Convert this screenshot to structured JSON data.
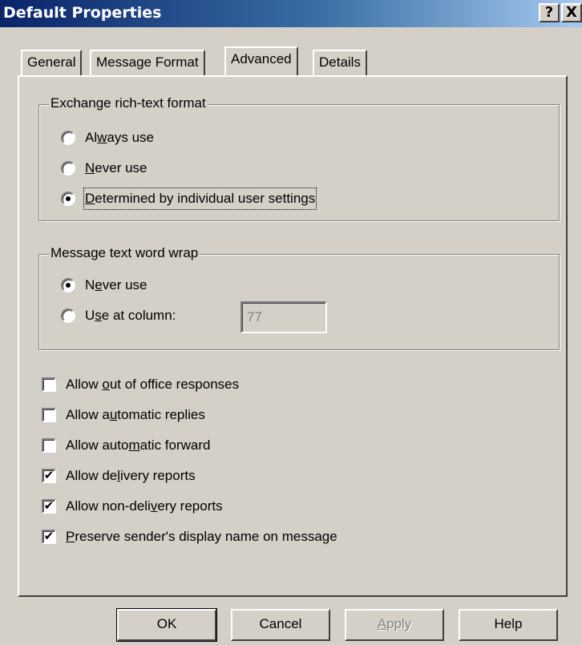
{
  "window": {
    "title": "Default Properties",
    "help_button": "?",
    "close_button": "X"
  },
  "tabs": [
    {
      "label": "General",
      "active": false
    },
    {
      "label": "Message Format",
      "active": false
    },
    {
      "label": "Advanced",
      "active": true
    },
    {
      "label": "Details",
      "active": false
    }
  ],
  "rich_text_group": {
    "legend": "Exchange rich-text format",
    "options": [
      {
        "pre": "Al",
        "key": "w",
        "post": "ays use",
        "selected": false
      },
      {
        "pre": "",
        "key": "N",
        "post": "ever use",
        "selected": false
      },
      {
        "pre": "",
        "key": "D",
        "post": "etermined by individual user settings",
        "selected": true
      }
    ]
  },
  "word_wrap_group": {
    "legend": "Message text word wrap",
    "options": [
      {
        "pre": "N",
        "key": "e",
        "post": "ver use",
        "selected": true
      },
      {
        "pre": "U",
        "key": "s",
        "post": "e at column:",
        "selected": false
      }
    ],
    "column_value": "77"
  },
  "checkboxes": [
    {
      "pre": "Allow ",
      "key": "o",
      "post": "ut of office responses",
      "checked": false
    },
    {
      "pre": "Allow a",
      "key": "u",
      "post": "tomatic replies",
      "checked": false
    },
    {
      "pre": "Allow auto",
      "key": "m",
      "post": "atic forward",
      "checked": false
    },
    {
      "pre": "Allow de",
      "key": "l",
      "post": "ivery reports",
      "checked": true
    },
    {
      "pre": "Allow non-deli",
      "key": "v",
      "post": "ery reports",
      "checked": true
    },
    {
      "pre": "",
      "key": "P",
      "post": "reserve sender's display name on message",
      "checked": true
    }
  ],
  "buttons": {
    "ok": "OK",
    "cancel": "Cancel",
    "apply_pre": "",
    "apply_key": "A",
    "apply_post": "pply",
    "help": "Help"
  },
  "check_glyph": "✔"
}
